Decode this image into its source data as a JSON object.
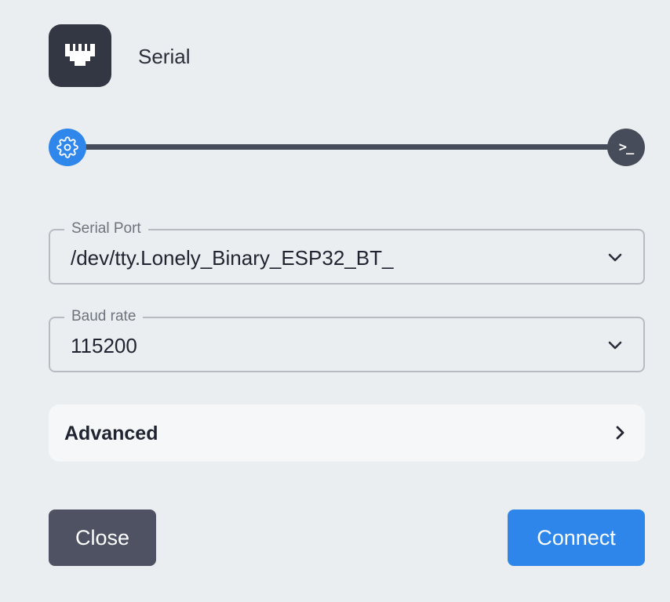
{
  "header": {
    "icon": "ethernet-port-icon",
    "title": "Serial"
  },
  "stepper": {
    "steps": [
      {
        "icon": "gear-icon",
        "state": "active",
        "color": "#2f86eb"
      },
      {
        "icon": "terminal-icon",
        "glyph": ">_",
        "state": "pending",
        "color": "#474c5a"
      }
    ]
  },
  "form": {
    "serial_port": {
      "label": "Serial Port",
      "value": "/dev/tty.Lonely_Binary_ESP32_BT_",
      "icon": "chevron-down-icon"
    },
    "baud_rate": {
      "label": "Baud rate",
      "value": "115200",
      "icon": "chevron-down-icon"
    },
    "advanced": {
      "label": "Advanced",
      "icon": "chevron-right-icon"
    }
  },
  "actions": {
    "close_label": "Close",
    "connect_label": "Connect",
    "close_color": "#4e5263",
    "connect_color": "#2e86eb"
  }
}
